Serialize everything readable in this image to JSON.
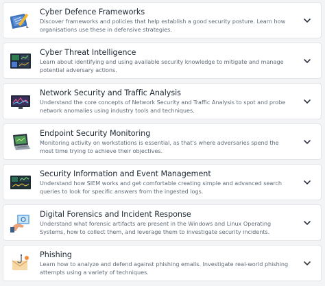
{
  "modules": [
    {
      "title": "Cyber Defence Frameworks",
      "description": "Discover frameworks and policies that help establish a good security posture. Learn how organisations use these in defensive strategies.",
      "icon": "blueprint-icon"
    },
    {
      "title": "Cyber Threat Intelligence",
      "description": "Learn about identifying and using available security knowledge to mitigate and manage potential adversary actions.",
      "icon": "threat-dashboard-icon"
    },
    {
      "title": "Network Security and Traffic Analysis",
      "description": "Understand the core concepts of Network Security and Traffic Analysis to spot and probe network anomalies using industry tools and techniques.",
      "icon": "network-monitor-icon"
    },
    {
      "title": "Endpoint Security Monitoring",
      "description": "Monitoring activity on workstations is essential, as that's where adversaries spend the most time trying to achieve their objectives.",
      "icon": "laptop-icon"
    },
    {
      "title": "Security Information and Event Management",
      "description": "Understand how SIEM works and get comfortable creating simple and advanced search queries to look for specific answers from the ingested logs.",
      "icon": "siem-dashboard-icon"
    },
    {
      "title": "Digital Forensics and Incident Response",
      "description": "Understand what forensic artifacts are present in the Windows and Linux Operating Systems, how to collect them, and leverage them to investigate security incidents.",
      "icon": "forensics-hand-icon"
    },
    {
      "title": "Phishing",
      "description": "Learn how to analyze and defend against phishing emails. Investigate real-world phishing attempts using a variety of techniques.",
      "icon": "phishing-hook-icon"
    }
  ],
  "colors": {
    "title": "#1d2733",
    "description": "#5e6a77",
    "chevron": "#2b3440",
    "card_border": "#e3e5e8",
    "page_bg": "#f3f4f6"
  }
}
